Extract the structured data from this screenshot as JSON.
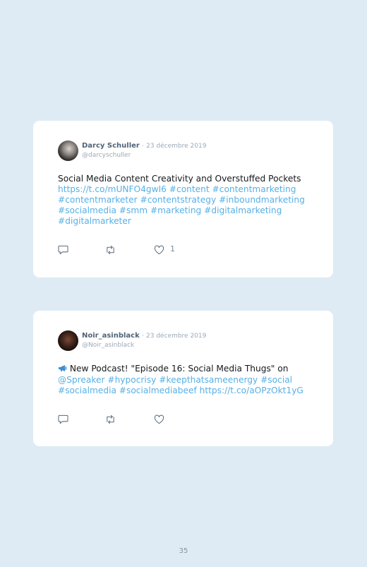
{
  "tweets": [
    {
      "name": "Darcy Schuller",
      "date": "23 décembre 2019",
      "handle": "@darcyschuller",
      "text": "Social Media Content Creativity and Overstuffed Pockets",
      "links": "https://t.co/mUNFO4gwI6 #content #contentmarketing #contentmarketer #contentstrategy #inboundmarketing #socialmedia #smm #marketing #digitalmarketing #digitalmarketer",
      "like_count": "1"
    },
    {
      "name": "Noir_asinblack",
      "date": "23 décembre 2019",
      "handle": "@Noir_asinblack",
      "text": "New Podcast! \"Episode 16: Social Media Thugs\" on",
      "links": "@Spreaker #hypocrisy #keepthatsameenergy #social #socialmedia #socialmediabeef https://t.co/aOPzOkt1yG",
      "like_count": ""
    }
  ],
  "separator": "·",
  "icons": [
    "reply-icon",
    "retweet-icon",
    "heart-icon",
    "megaphone-icon"
  ],
  "colors": {
    "background": "#deebf4",
    "link": "#56b0e5",
    "name": "#4f6478"
  },
  "page_number": "35"
}
